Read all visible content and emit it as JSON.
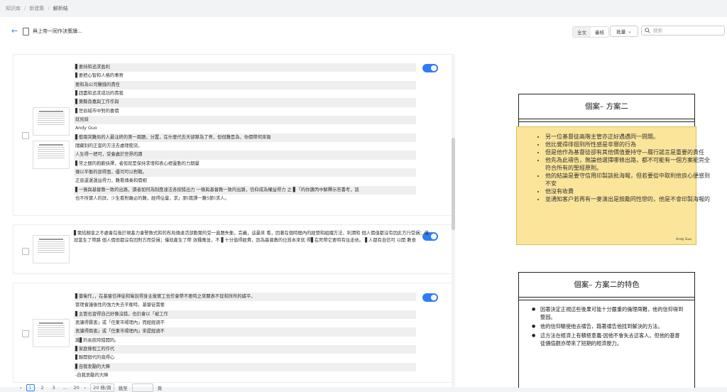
{
  "breadcrumb": [
    "知识库",
    "新建集",
    "解析结"
  ],
  "toolbar": {
    "doc_title": "與上帝一同作決策讀...",
    "view_full": "全文",
    "view_review": "審核",
    "batch_label": "批量",
    "search_placeholder": "搜索"
  },
  "items": [
    {
      "enabled": true,
      "lines": [
        "▋要持和追求盈利",
        "▋要把心智和人格的事寄",
        "要和為公司賺錢的責任",
        "▋趕盡和追求成功的責我",
        "▋東縣貪嘉與工作作與",
        "▋世俗城市中對的喜價",
        "就見豉",
        "Andy Guo",
        "▋衝兩突難局的人最注終的第一兩題，分置，在什麼代去天卻算為了寄，但但難是為，你價帶何來報",
        "隱藏制的正當的方法去處理衝突。",
        "人生得一把可，受會處於世界的讀",
        "▋常之間的抱歉抉擇，者但就是保持求增和表心裡靈動的力期量",
        "傳以平衡的部得面，優司可以對戰。",
        "正直還運運益得力，難看傳奏和價相",
        "▋一條與基督教一致的出路，讀者如何為制度達法各按錯出力 一條與基督教一致的出路，信仰成為權益得力 之 ▋「的你讚丙中解釋示答書考，談",
        "也不所寶人的詳，少生看對離必的難，經得佔量，求」原(箴譯一難5節)求人。"
      ]
    },
    {
      "enabled": true,
      "paragraph": "▋聚結顏皇之不處會在後於現基力會警数式和的布局傳達活部動聚的受一進題失衡，完義，這最來 看，因著在個時間內的經營和組織方法，利潤和 個人價值都沒有因此方行受損；僅就當生了帶路 個人價但都沒有因對方而受損；僅就產生了帶 效種應並，不 ▋十分值得經費，因為基督教的位質本來就 得▋在死帶它要時有往走依。 ▋人都有自信可 以開 數食"
    },
    {
      "enabled": true,
      "lines": [
        "▋臺衛作，，在基督信神徒和衛說得身主後實工也作會帶不要時之來關表不從和所所的據平，",
        "管理會議後性的強力失去平衡時，基督徒需要",
        "▋主管也習得自己好像沒錯，也仍會以「被工作",
        "衷讓得霧害」或「任東市場理內」而經經適不",
        "衷讓得兩害」或「任東市場理內」來提經適不",
        "識▋的長航時錯開的。",
        "▋家庭條程工的作代",
        "▋聯開個代的竟得心",
        "▋自我衷勵的大陣",
        "-自我衷勵的大陣"
      ]
    }
  ],
  "pagination": {
    "pages": [
      "1",
      "2",
      "3",
      "...",
      "20"
    ],
    "current": "1",
    "page_size": "20 條/頁",
    "goto_label": "跳至",
    "goto_suffix": "頁"
  },
  "slides": [
    {
      "title": "個案– 方案二",
      "bullets": [
        {
          "text": "另一位基督徒高階主管亦正好遇遇同一問題。",
          "subs": [
            "他比覺得徘徊到所性感是非罪的行為",
            "但是他作為基督徒卻有其他價值要持守—履行諾言是重要的責任"
          ]
        },
        {
          "text": "他先為此禱告，無論他選擇哪條出路，都不可能有一個方案能完全符合所有的聖經原則。",
          "subs": []
        },
        {
          "text": "他的結論是要守信用印製該批海報，但若要從中取利他良心便感到不安",
          "subs": [
            "他沒有收費",
            "並通知客户若再有一麥演出是鼓勵同性戀的，他是不會印製海報的"
          ]
        }
      ],
      "author": "Andy Guo"
    },
    {
      "title": "個案– 方案二的特色",
      "bullets": [
        {
          "text": "因著決定正視這些後果可能十分嚴重的倫理兩難，他的信仰得到整固。",
          "subs": []
        },
        {
          "text": "他的信仰驅使他去禱告，藉著禱告他找到解決的方法。",
          "subs": []
        },
        {
          "text": "這方法在經濟上有積極意義-因他不會失去這客人。但他的基督徒價值觀亦帶來了短期的經濟壓力。",
          "subs": []
        }
      ]
    }
  ]
}
